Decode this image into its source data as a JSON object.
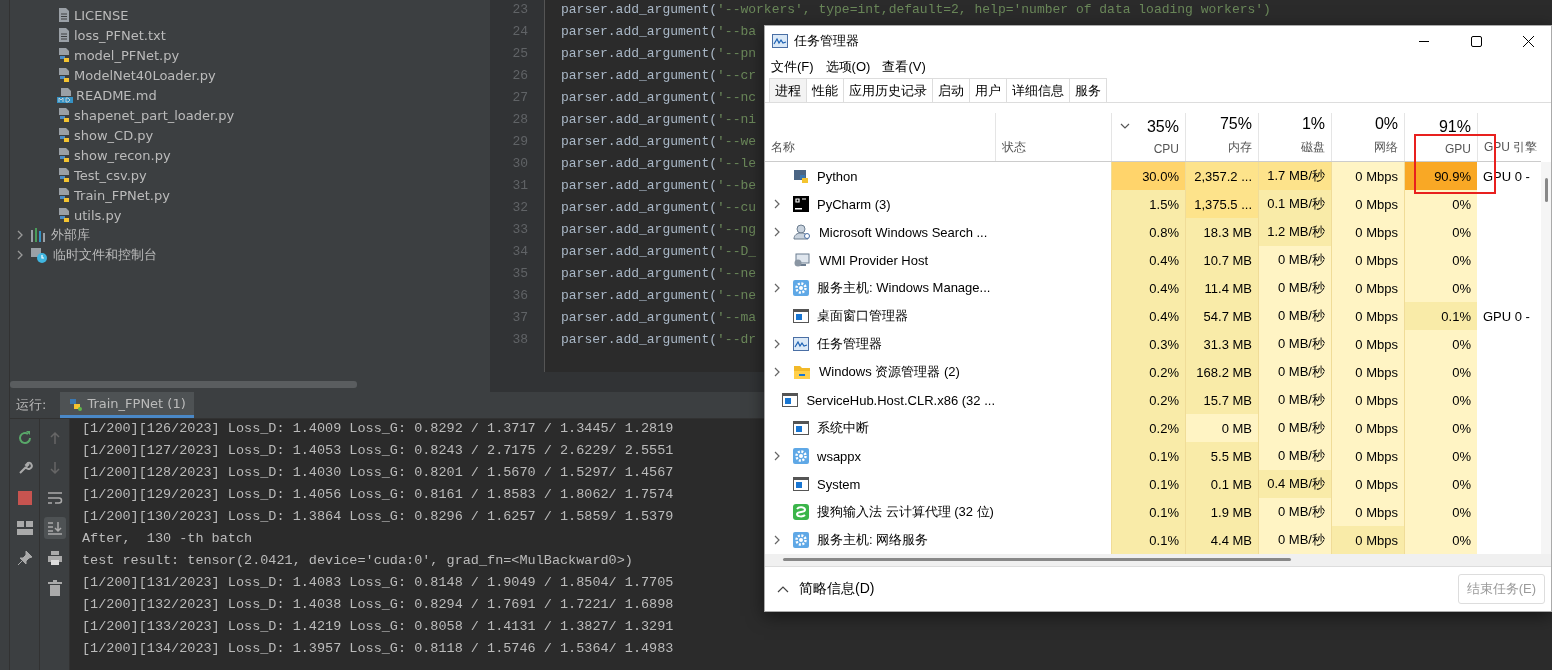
{
  "project_tree": {
    "files": [
      {
        "label": "LICENSE",
        "kind": "text"
      },
      {
        "label": "loss_PFNet.txt",
        "kind": "text"
      },
      {
        "label": "model_PFNet.py",
        "kind": "python"
      },
      {
        "label": "ModelNet40Loader.py",
        "kind": "python"
      },
      {
        "label": "README.md",
        "kind": "markdown"
      },
      {
        "label": "shapenet_part_loader.py",
        "kind": "python"
      },
      {
        "label": "show_CD.py",
        "kind": "python"
      },
      {
        "label": "show_recon.py",
        "kind": "python"
      },
      {
        "label": "Test_csv.py",
        "kind": "python"
      },
      {
        "label": "Train_FPNet.py",
        "kind": "python"
      },
      {
        "label": "utils.py",
        "kind": "python"
      }
    ],
    "nodes": [
      {
        "label": "外部库",
        "kind": "library",
        "expanded": false
      },
      {
        "label": "临时文件和控制台",
        "kind": "scratch",
        "expanded": false
      }
    ]
  },
  "editor": {
    "lines": [
      {
        "number": "23",
        "code": "parser.add_argument('--workers', type=int,default=2, help='number of data loading workers')"
      },
      {
        "number": "24",
        "code": "parser.add_argument('--ba"
      },
      {
        "number": "25",
        "code": "parser.add_argument('--pn"
      },
      {
        "number": "26",
        "code": "parser.add_argument('--cr"
      },
      {
        "number": "27",
        "code": "parser.add_argument('--nc"
      },
      {
        "number": "28",
        "code": "parser.add_argument('--ni"
      },
      {
        "number": "29",
        "code": "parser.add_argument('--we"
      },
      {
        "number": "30",
        "code": "parser.add_argument('--le"
      },
      {
        "number": "31",
        "code": "parser.add_argument('--be"
      },
      {
        "number": "32",
        "code": "parser.add_argument('--cu"
      },
      {
        "number": "33",
        "code": "parser.add_argument('--ng"
      },
      {
        "number": "34",
        "code": "parser.add_argument('--D_"
      },
      {
        "number": "35",
        "code": "parser.add_argument('--ne"
      },
      {
        "number": "36",
        "code": "parser.add_argument('--ne"
      },
      {
        "number": "37",
        "code": "parser.add_argument('--ma"
      },
      {
        "number": "38",
        "code": "parser.add_argument('--dr"
      }
    ]
  },
  "run_panel": {
    "label": "运行:",
    "tab": "Train_FPNet (1)",
    "scroll_to_end": true,
    "console": [
      "[1/200][126/2023] Loss_D: 1.4009 Loss_G: 0.8292 / 1.3717 / 1.3445/ 1.2819",
      "[1/200][127/2023] Loss_D: 1.4053 Loss_G: 0.8243 / 2.7175 / 2.6229/ 2.5551",
      "[1/200][128/2023] Loss_D: 1.4030 Loss_G: 0.8201 / 1.5670 / 1.5297/ 1.4567",
      "[1/200][129/2023] Loss_D: 1.4056 Loss_G: 0.8161 / 1.8583 / 1.8062/ 1.7574",
      "[1/200][130/2023] Loss_D: 1.3864 Loss_G: 0.8296 / 1.6257 / 1.5859/ 1.5379",
      "After,  130 -th batch",
      "test result: tensor(2.0421, device='cuda:0', grad_fn=<MulBackward0>)",
      "[1/200][131/2023] Loss_D: 1.4083 Loss_G: 0.8148 / 1.9049 / 1.8504/ 1.7705",
      "[1/200][132/2023] Loss_D: 1.4038 Loss_G: 0.8294 / 1.7691 / 1.7221/ 1.6898",
      "[1/200][133/2023] Loss_D: 1.4219 Loss_G: 0.8058 / 1.4131 / 1.3827/ 1.3291",
      "[1/200][134/2023] Loss_D: 1.3957 Loss_G: 0.8118 / 1.5746 / 1.5364/ 1.4983"
    ]
  },
  "task_manager": {
    "title": "任务管理器",
    "menu": [
      "文件(F)",
      "选项(O)",
      "查看(V)"
    ],
    "tabs": [
      {
        "label": "进程",
        "selected": true
      },
      {
        "label": "性能",
        "selected": false
      },
      {
        "label": "应用历史记录",
        "selected": false
      },
      {
        "label": "启动",
        "selected": false
      },
      {
        "label": "用户",
        "selected": false
      },
      {
        "label": "详细信息",
        "selected": false
      },
      {
        "label": "服务",
        "selected": false
      }
    ],
    "columns": {
      "name": "名称",
      "status": "状态",
      "metrics": [
        {
          "percent": "35%",
          "label": "CPU",
          "sorted": true
        },
        {
          "percent": "75%",
          "label": "内存",
          "sorted": false
        },
        {
          "percent": "1%",
          "label": "磁盘",
          "sorted": false
        },
        {
          "percent": "0%",
          "label": "网络",
          "sorted": false
        },
        {
          "percent": "91%",
          "label": "GPU",
          "sorted": false
        }
      ],
      "engine": "GPU 引擎"
    },
    "rows": [
      {
        "name": "Python",
        "kind": "python",
        "has_children": false,
        "values": [
          {
            "text": "30.0%",
            "color": "#ffd46b"
          },
          {
            "text": "2,357.2 ...",
            "color": "#fde38b"
          },
          {
            "text": "1.7 MB/秒",
            "color": "#fde38b"
          },
          {
            "text": "0 Mbps",
            "color": "#fff4c4"
          },
          {
            "text": "90.9%",
            "color": "#f9a825"
          }
        ],
        "engine": "GPU 0 -"
      },
      {
        "name": "PyCharm (3)",
        "kind": "pycharm",
        "has_children": true,
        "values": [
          {
            "text": "1.5%",
            "color": "#f9eba8"
          },
          {
            "text": "1,375.5 ...",
            "color": "#fde38b"
          },
          {
            "text": "0.1 MB/秒",
            "color": "#f9eba8"
          },
          {
            "text": "0 Mbps",
            "color": "#fff4c4"
          },
          {
            "text": "0%",
            "color": "#fff4c4"
          }
        ]
      },
      {
        "name": "Microsoft Windows Search ...",
        "kind": "search",
        "has_children": true,
        "values": [
          {
            "text": "0.8%",
            "color": "#f9eba8"
          },
          {
            "text": "18.3 MB",
            "color": "#f9eba8"
          },
          {
            "text": "1.2 MB/秒",
            "color": "#f9eba8"
          },
          {
            "text": "0 Mbps",
            "color": "#fff4c4"
          },
          {
            "text": "0%",
            "color": "#fff4c4"
          }
        ]
      },
      {
        "name": "WMI Provider Host",
        "kind": "wmi",
        "has_children": false,
        "values": [
          {
            "text": "0.4%",
            "color": "#f9eba8"
          },
          {
            "text": "10.7 MB",
            "color": "#f9eba8"
          },
          {
            "text": "0 MB/秒",
            "color": "#fff4c4"
          },
          {
            "text": "0 Mbps",
            "color": "#fff4c4"
          },
          {
            "text": "0%",
            "color": "#fff4c4"
          }
        ]
      },
      {
        "name": "服务主机: Windows Manage...",
        "kind": "gear",
        "has_children": true,
        "values": [
          {
            "text": "0.4%",
            "color": "#f9eba8"
          },
          {
            "text": "11.4 MB",
            "color": "#f9eba8"
          },
          {
            "text": "0 MB/秒",
            "color": "#fff4c4"
          },
          {
            "text": "0 Mbps",
            "color": "#fff4c4"
          },
          {
            "text": "0%",
            "color": "#fff4c4"
          }
        ]
      },
      {
        "name": "桌面窗口管理器",
        "kind": "window",
        "has_children": false,
        "values": [
          {
            "text": "0.4%",
            "color": "#f9eba8"
          },
          {
            "text": "54.7 MB",
            "color": "#f9eba8"
          },
          {
            "text": "0 MB/秒",
            "color": "#fff4c4"
          },
          {
            "text": "0 Mbps",
            "color": "#fff4c4"
          },
          {
            "text": "0.1%",
            "color": "#f9eba8"
          }
        ],
        "engine": "GPU 0 -"
      },
      {
        "name": "任务管理器",
        "kind": "monitor",
        "has_children": true,
        "values": [
          {
            "text": "0.3%",
            "color": "#f9eba8"
          },
          {
            "text": "31.3 MB",
            "color": "#f9eba8"
          },
          {
            "text": "0 MB/秒",
            "color": "#fff4c4"
          },
          {
            "text": "0 Mbps",
            "color": "#fff4c4"
          },
          {
            "text": "0%",
            "color": "#fff4c4"
          }
        ]
      },
      {
        "name": "Windows 资源管理器 (2)",
        "kind": "folder",
        "has_children": true,
        "values": [
          {
            "text": "0.2%",
            "color": "#f9eba8"
          },
          {
            "text": "168.2 MB",
            "color": "#f9eba8"
          },
          {
            "text": "0 MB/秒",
            "color": "#fff4c4"
          },
          {
            "text": "0 Mbps",
            "color": "#fff4c4"
          },
          {
            "text": "0%",
            "color": "#fff4c4"
          }
        ]
      },
      {
        "name": "ServiceHub.Host.CLR.x86 (32 ...",
        "kind": "window",
        "has_children": false,
        "values": [
          {
            "text": "0.2%",
            "color": "#f9eba8"
          },
          {
            "text": "15.7 MB",
            "color": "#f9eba8"
          },
          {
            "text": "0 MB/秒",
            "color": "#fff4c4"
          },
          {
            "text": "0 Mbps",
            "color": "#fff4c4"
          },
          {
            "text": "0%",
            "color": "#fff4c4"
          }
        ]
      },
      {
        "name": "系统中断",
        "kind": "window",
        "has_children": false,
        "values": [
          {
            "text": "0.2%",
            "color": "#f9eba8"
          },
          {
            "text": "0 MB",
            "color": "#fff4c4"
          },
          {
            "text": "0 MB/秒",
            "color": "#fff4c4"
          },
          {
            "text": "0 Mbps",
            "color": "#fff4c4"
          },
          {
            "text": "0%",
            "color": "#fff4c4"
          }
        ]
      },
      {
        "name": "wsappx",
        "kind": "gear",
        "has_children": true,
        "values": [
          {
            "text": "0.1%",
            "color": "#f9eba8"
          },
          {
            "text": "5.5 MB",
            "color": "#f9eba8"
          },
          {
            "text": "0 MB/秒",
            "color": "#fff4c4"
          },
          {
            "text": "0 Mbps",
            "color": "#fff4c4"
          },
          {
            "text": "0%",
            "color": "#fff4c4"
          }
        ]
      },
      {
        "name": "System",
        "kind": "window",
        "has_children": false,
        "values": [
          {
            "text": "0.1%",
            "color": "#f9eba8"
          },
          {
            "text": "0.1 MB",
            "color": "#f9eba8"
          },
          {
            "text": "0.4 MB/秒",
            "color": "#f9eba8"
          },
          {
            "text": "0 Mbps",
            "color": "#fff4c4"
          },
          {
            "text": "0%",
            "color": "#fff4c4"
          }
        ]
      },
      {
        "name": "搜狗输入法 云计算代理 (32 位)",
        "kind": "sogou",
        "has_children": false,
        "values": [
          {
            "text": "0.1%",
            "color": "#f9eba8"
          },
          {
            "text": "1.9 MB",
            "color": "#f9eba8"
          },
          {
            "text": "0 MB/秒",
            "color": "#fff4c4"
          },
          {
            "text": "0 Mbps",
            "color": "#fff4c4"
          },
          {
            "text": "0%",
            "color": "#fff4c4"
          }
        ]
      },
      {
        "name": "服务主机: 网络服务",
        "kind": "gear",
        "has_children": true,
        "values": [
          {
            "text": "0.1%",
            "color": "#f9eba8"
          },
          {
            "text": "4.4 MB",
            "color": "#f9eba8"
          },
          {
            "text": "0 MB/秒",
            "color": "#fff4c4"
          },
          {
            "text": "0 Mbps",
            "color": "#f9eba8"
          },
          {
            "text": "0%",
            "color": "#fff4c4"
          }
        ]
      }
    ],
    "footer": {
      "details": "简略信息(D)",
      "end_task": "结束任务(E)",
      "end_task_disabled": true
    }
  }
}
